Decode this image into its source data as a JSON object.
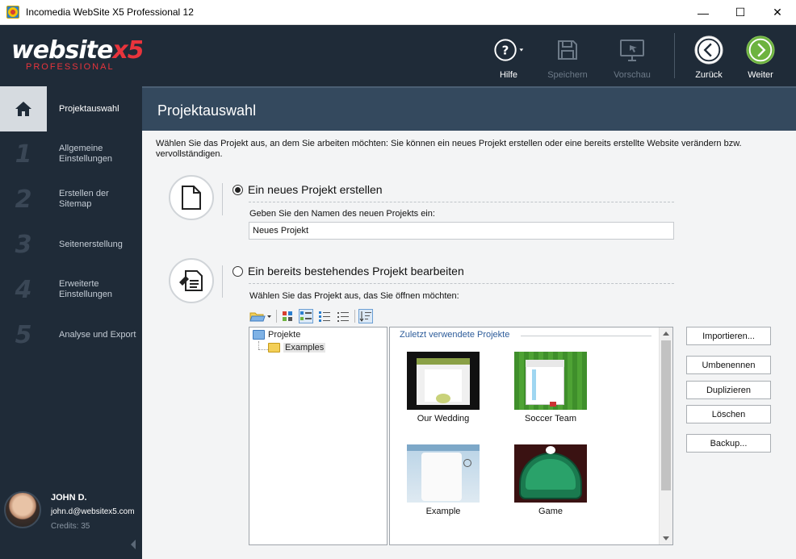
{
  "window": {
    "title": "Incomedia WebSite X5 Professional 12",
    "minimize": "—",
    "maximize": "☐",
    "close": "✕"
  },
  "logo": {
    "word_main": "website",
    "word_accent": "x5",
    "edition": "PROFESSIONAL"
  },
  "sidebar": {
    "items": [
      {
        "num": "",
        "label": "Projektauswahl",
        "active": true
      },
      {
        "num": "1",
        "label": "Allgemeine Einstellungen"
      },
      {
        "num": "2",
        "label": "Erstellen der Sitemap"
      },
      {
        "num": "3",
        "label": "Seitenerstellung"
      },
      {
        "num": "4",
        "label": "Erweiterte Einstellungen"
      },
      {
        "num": "5",
        "label": "Analyse und Export"
      }
    ]
  },
  "user": {
    "name": "JOHN D.",
    "email": "john.d@websitex5.com",
    "credits": "Credits: 35"
  },
  "toolbar": {
    "help": "Hilfe",
    "save": "Speichern",
    "preview": "Vorschau",
    "back": "Zurück",
    "next": "Weiter"
  },
  "page": {
    "title": "Projektauswahl",
    "intro": "Wählen Sie das Projekt aus, an dem Sie arbeiten möchten: Sie können ein neues Projekt erstellen oder eine bereits erstellte Website verändern bzw. vervollständigen."
  },
  "new_project": {
    "option": "Ein neues Projekt erstellen",
    "prompt": "Geben Sie den Namen des neuen Projekts ein:",
    "value": "Neues Projekt"
  },
  "existing_project": {
    "option": "Ein bereits bestehendes Projekt bearbeiten",
    "prompt": "Wählen Sie das Projekt aus, das Sie öffnen möchten:"
  },
  "tree": {
    "root": "Projekte",
    "child": "Examples"
  },
  "recent": {
    "heading": "Zuletzt verwendete Projekte",
    "projects": [
      {
        "name": "Our Wedding"
      },
      {
        "name": "Soccer Team"
      },
      {
        "name": "Example"
      },
      {
        "name": "Game"
      }
    ]
  },
  "actions": {
    "import": "Importieren...",
    "rename": "Umbenennen",
    "duplicate": "Duplizieren",
    "delete": "Löschen",
    "backup": "Backup..."
  },
  "colors": {
    "sidebar_bg": "#1f2b38",
    "header_bg": "#34495e",
    "next_green": "#6db33f",
    "logo_red": "#e8343c"
  }
}
